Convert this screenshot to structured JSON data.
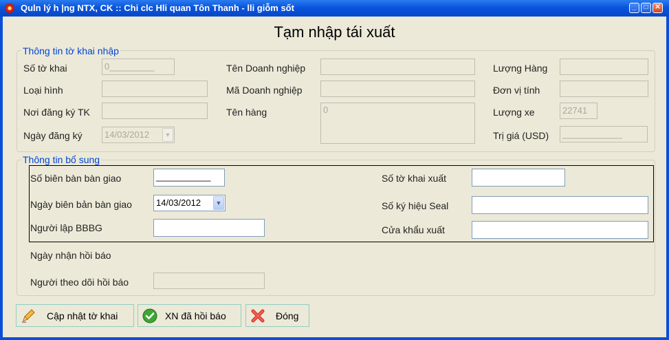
{
  "window": {
    "title": "Quln lý h |ng NTX, CK :: Chi clc Hli quan Tôn Thanh - lli giỗm sốt"
  },
  "heading": "Tạm nhập tái xuất",
  "import_info": {
    "legend": "Thông tin tờ khai nhập",
    "declaration_no": {
      "label": "Số tờ khai",
      "value": "0_________"
    },
    "type": {
      "label": "Loại hình",
      "value": ""
    },
    "reg_place": {
      "label": "Nơi đăng ký TK",
      "value": ""
    },
    "reg_date": {
      "label": "Ngày đăng ký",
      "value": "14/03/2012"
    },
    "company_name": {
      "label": "Tên Doanh nghiệp",
      "value": ""
    },
    "company_code": {
      "label": "Mã Doanh nghiệp",
      "value": ""
    },
    "goods_name": {
      "label": "Tên hàng",
      "value": "0"
    },
    "goods_qty": {
      "label": "Lượng Hàng",
      "value": ""
    },
    "unit": {
      "label": "Đơn vị tính",
      "value": ""
    },
    "vehicles": {
      "label": "Lượng xe",
      "value": "22741"
    },
    "value_usd": {
      "label": "Trị giá (USD)",
      "value": "____________"
    }
  },
  "extra_info": {
    "legend": "Thông tin bổ sung",
    "handover_no": {
      "label": "Số biên bàn bàn giao",
      "value": "___________"
    },
    "handover_date": {
      "label": "Ngày biên bản bàn giao",
      "value": "14/03/2012"
    },
    "creator": {
      "label": "Người lập BBBG",
      "value": ""
    },
    "export_decl_no": {
      "label": "Số tờ khai xuất",
      "value": ""
    },
    "seal_no": {
      "label": "Số ký hiệu Seal",
      "value": ""
    },
    "export_gate": {
      "label": "Cửa khẩu xuất",
      "value": ""
    },
    "feedback_date": {
      "label": "Ngày nhận hồi báo"
    },
    "follower": {
      "label": "Người theo dõi hồi báo",
      "value": ""
    }
  },
  "buttons": {
    "update": "Cập nhật tờ khai",
    "confirm": "XN đã hồi báo",
    "close": "Đóng"
  },
  "icons": {
    "update": "pencil-icon",
    "confirm": "check-icon",
    "close": "close-x-icon",
    "app": "app-logo-icon"
  }
}
